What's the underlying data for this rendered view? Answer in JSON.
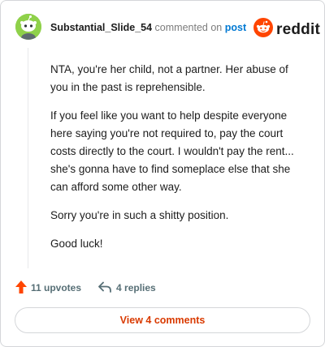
{
  "header": {
    "username": "Substantial_Slide_54",
    "commented_on": "commented on",
    "post_link": "post",
    "logo_text": "reddit",
    "avatar_icon": "snoo-avatar-icon",
    "logo_icon": "reddit-snoo-icon"
  },
  "comment": {
    "paragraphs": [
      "NTA, you're her child, not a partner. Her abuse of you in the past is reprehensible.",
      "If you feel like you want to help despite everyone here saying you're not required to, pay the court costs directly to the court. I wouldn't pay the rent... she's gonna have to find someplace else that she can afford some other way.",
      "Sorry you're in such a shitty position.",
      "Good luck!"
    ]
  },
  "actions": {
    "upvotes_label": "11 upvotes",
    "replies_label": "4 replies",
    "upvote_icon": "upvote-arrow-icon",
    "reply_icon": "reply-arrow-icon"
  },
  "footer": {
    "view_comments_label": "View 4 comments"
  },
  "colors": {
    "accent": "#ff4500",
    "link": "#0079d3",
    "button_text": "#d93a00",
    "avatar_bg": "#8fd14a"
  }
}
